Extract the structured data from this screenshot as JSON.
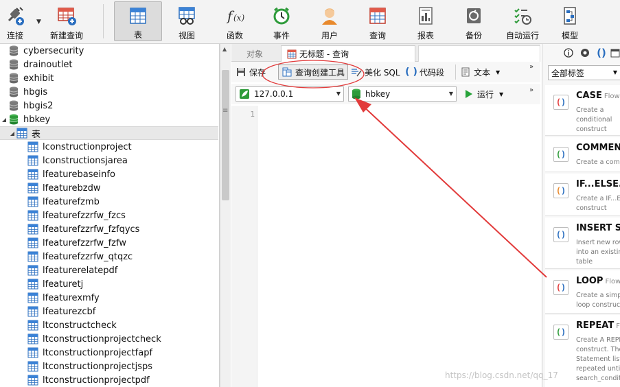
{
  "toolbar": {
    "buttons": [
      {
        "id": "connect",
        "label": "连接",
        "icon": "plug-icon"
      },
      {
        "id": "new-query",
        "label": "新建查询",
        "icon": "new-query-grid-icon"
      },
      {
        "id": "table",
        "label": "表",
        "icon": "table-grid-icon",
        "active": true
      },
      {
        "id": "view",
        "label": "视图",
        "icon": "glasses-grid-icon"
      },
      {
        "id": "function",
        "label": "函数",
        "icon": "function-fx-icon"
      },
      {
        "id": "event",
        "label": "事件",
        "icon": "alarm-clock-icon"
      },
      {
        "id": "user",
        "label": "用户",
        "icon": "user-icon"
      },
      {
        "id": "query",
        "label": "查询",
        "icon": "query-grid-icon"
      },
      {
        "id": "report",
        "label": "报表",
        "icon": "report-icon"
      },
      {
        "id": "backup",
        "label": "备份",
        "icon": "backup-icon"
      },
      {
        "id": "automation",
        "label": "自动运行",
        "icon": "checklist-clock-icon"
      },
      {
        "id": "model",
        "label": "模型",
        "icon": "model-icon"
      }
    ]
  },
  "navigator": {
    "databases": [
      {
        "name": "cybersecurity",
        "open": false
      },
      {
        "name": "drainoutlet",
        "open": false
      },
      {
        "name": "exhibit",
        "open": false
      },
      {
        "name": "hbgis",
        "open": false
      },
      {
        "name": "hbgis2",
        "open": false
      },
      {
        "name": "hbkey",
        "open": true
      }
    ],
    "tables_group_label": "表",
    "tables": [
      "lconstructionproject",
      "lconstructionsjarea",
      "lfeaturebaseinfo",
      "lfeaturebzdw",
      "lfeaturefzmb",
      "lfeaturefzzrfw_fzcs",
      "lfeaturefzzrfw_fzfqycs",
      "lfeaturefzzrfw_fzfw",
      "lfeaturefzzrfw_qtqzc",
      "lfeaturerelatepdf",
      "lfeaturetj",
      "lfeaturexmfy",
      "lfeaturezcbf",
      "ltconstructcheck",
      "ltconstructionprojectcheck",
      "ltconstructionprojectfapf",
      "ltconstructionprojectjsps",
      "ltconstructionprojectpdf"
    ]
  },
  "tabs": {
    "objects": "对象",
    "query_tab": "无标题 - 查询"
  },
  "editor_toolbar": {
    "save": "保存",
    "query_builder": "查询创建工具",
    "beautify": "美化 SQL",
    "snippet": "代码段",
    "text": "文本",
    "more": "»"
  },
  "connection_bar": {
    "connection": "127.0.0.1",
    "database": "hbkey",
    "run": "运行"
  },
  "editor": {
    "line_numbers": [
      "1"
    ]
  },
  "snippets_panel": {
    "filter": "全部标签",
    "items": [
      {
        "title": "CASE",
        "sub": "Flow C",
        "desc": [
          "Create a",
          "conditional",
          "construct"
        ]
      },
      {
        "title": "COMMENT",
        "sub": "",
        "desc": [
          "Create a comm"
        ]
      },
      {
        "title": "IF...ELSE...",
        "sub": "",
        "desc": [
          "Create a IF...ELS",
          "construct"
        ]
      },
      {
        "title": "INSERT Syn",
        "sub": "",
        "desc": [
          "Insert new rows",
          "into an existing",
          "table"
        ]
      },
      {
        "title": "LOOP",
        "sub": "Flow C",
        "desc": [
          "Create a simple",
          "loop construct"
        ]
      },
      {
        "title": "REPEAT",
        "sub": "Flow",
        "desc": [
          "Create A REPEA",
          "construct. The",
          "Statement list is",
          "repeated until t",
          "search_conditio"
        ]
      }
    ]
  },
  "watermark": "https://blog.csdn.net/qq_17",
  "colors": {
    "db_icon": "#7a7a7a",
    "db_open": "#2e9b3a",
    "table_icon": "#2a6ebf",
    "annotation_red": "#e23b3b",
    "run_green": "#27a33a"
  }
}
